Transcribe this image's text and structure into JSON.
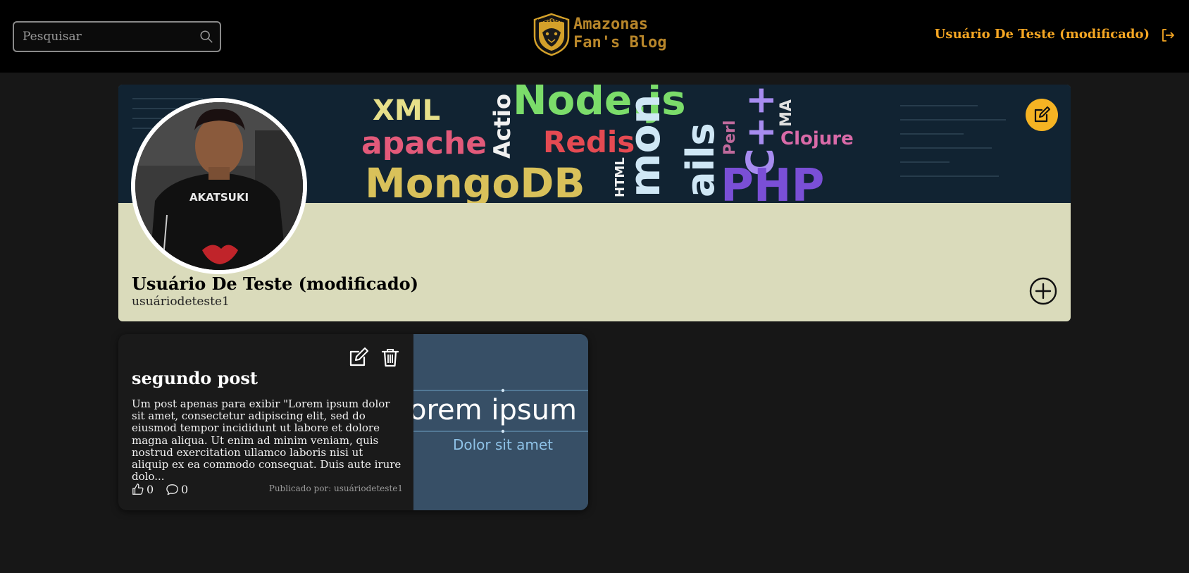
{
  "header": {
    "search": {
      "placeholder": "Pesquisar",
      "value": ""
    },
    "logo": {
      "badge_text": "AMAZONAS F.C.",
      "title_line1": "Amazonas",
      "title_line2": "Fan's Blog"
    },
    "user_name": "Usuário De Teste (modificado)"
  },
  "banner": {
    "words": [
      "XML",
      "Node.js",
      "apache",
      "Redis",
      "Actio",
      "MongoDB",
      "HTML",
      "mon",
      "ails",
      "Perl",
      "C++",
      "MA",
      "Clojure",
      "PHP"
    ]
  },
  "profile": {
    "avatar_shirt_text": "AKATSUKI",
    "name": "Usuário De Teste (modificado)",
    "username": "usuáriodeteste1"
  },
  "posts": [
    {
      "title": "segundo post",
      "excerpt": "Um post apenas para exibir \"Lorem ipsum dolor sit amet, consectetur adipiscing elit, sed do eiusmod tempor incididunt ut labore et dolore magna aliqua. Ut enim ad minim veniam, quis nostrud exercitation ullamco laboris nisi ut aliquip ex ea commodo consequat. Duis aute irure dolo...",
      "likes": "0",
      "comments": "0",
      "published_by": "Publicado por: usuáriodeteste1",
      "image_text_main": "orem ipsum",
      "image_text_sub": "Dolor sit amet"
    }
  ],
  "colors": {
    "accent": "#f5a623",
    "profile_bg": "#dadbbb",
    "page_bg": "#171717",
    "post_image_bg": "#374f66"
  }
}
